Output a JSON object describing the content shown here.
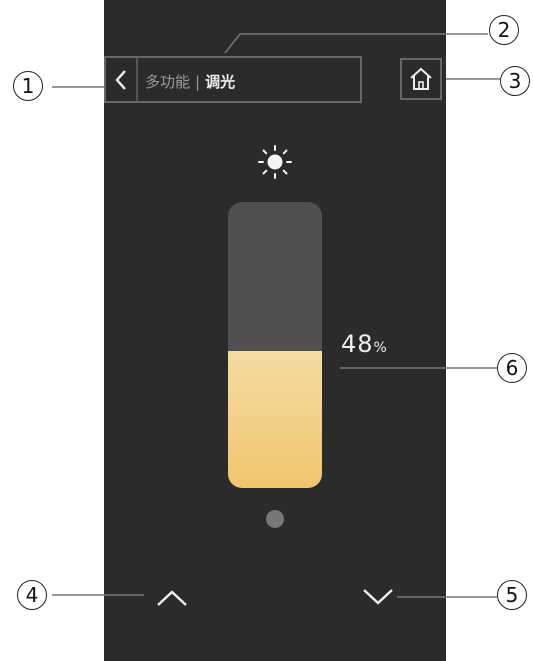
{
  "header": {
    "back_glyph": "<",
    "section": "多功能",
    "separator": "|",
    "current": "调光"
  },
  "home": {
    "icon": "home-icon"
  },
  "dimmer": {
    "icon": "sun-icon",
    "level_percent": 48,
    "value": "48",
    "unit": "%"
  },
  "pager": {
    "pages": 1,
    "active": 1
  },
  "controls": {
    "up_icon": "chevron-up-icon",
    "down_icon": "chevron-down-icon"
  },
  "callouts": [
    "1",
    "2",
    "3",
    "4",
    "5",
    "6"
  ],
  "colors": {
    "panel": "#2b2b2b",
    "fill_top": "#f5dca3",
    "fill_bottom": "#f0c56e",
    "track": "#505050"
  }
}
